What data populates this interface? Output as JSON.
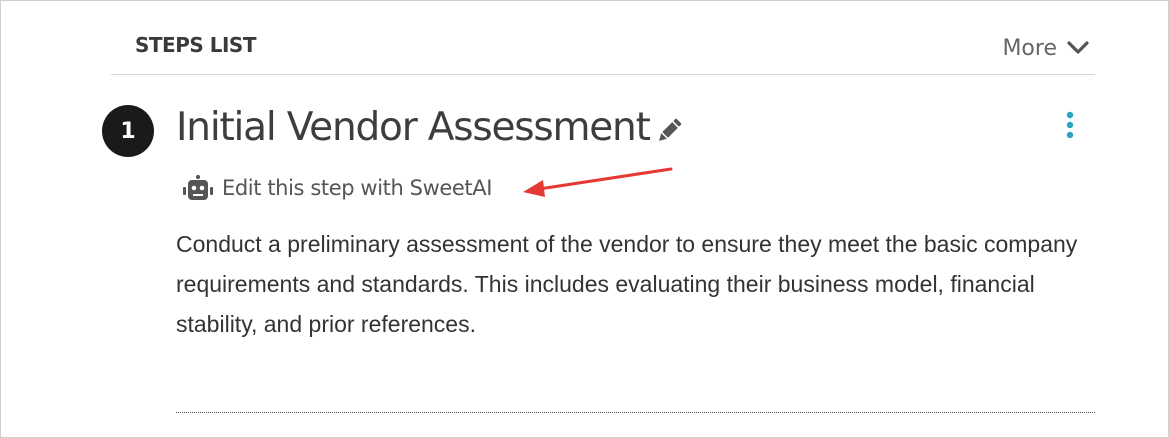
{
  "header": {
    "title": "STEPS LIST",
    "more_label": "More",
    "more_icon": "chevron-down-icon"
  },
  "step": {
    "number": "1",
    "title": "Initial Vendor Assessment",
    "edit_icon": "pencil-icon",
    "menu_icon": "kebab-menu-icon",
    "ai_link_label": "Edit this step with SweetAI",
    "ai_icon": "robot-icon",
    "description": "Conduct a preliminary assessment of the vendor to ensure they meet the basic company requirements and standards. This includes evaluating their business model, financial stability, and prior references."
  },
  "colors": {
    "badge": "#1a1a1a",
    "kebab": "#2aa3c0",
    "annotation_arrow": "#e53935",
    "text_dark": "#333333",
    "text_muted": "#666666"
  }
}
